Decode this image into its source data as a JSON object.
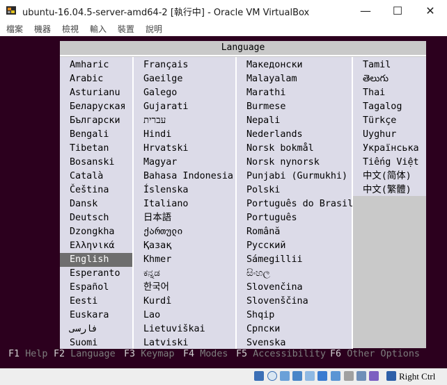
{
  "window": {
    "title": "ubuntu-16.04.5-server-amd64-2 [執行中] - Oracle VM VirtualBox",
    "minimize_glyph": "—",
    "maximize_glyph": "☐",
    "close_glyph": "✕"
  },
  "menubar": {
    "items": [
      "檔案",
      "機器",
      "檢視",
      "輸入",
      "裝置",
      "說明"
    ]
  },
  "dialog": {
    "title": "Language",
    "columns": [
      [
        "Amharic",
        "Arabic",
        "Asturianu",
        "Беларуская",
        "Български",
        "Bengali",
        "Tibetan",
        "Bosanski",
        "Català",
        "Čeština",
        "Dansk",
        "Deutsch",
        "Dzongkha",
        "Ελληνικά",
        "English",
        "Esperanto",
        "Español",
        "Eesti",
        "Euskara",
        "فارسی",
        "Suomi"
      ],
      [
        "Français",
        "Gaeilge",
        "Galego",
        "Gujarati",
        "עברית",
        "Hindi",
        "Hrvatski",
        "Magyar",
        "Bahasa Indonesia",
        "Íslenska",
        "Italiano",
        "日本語",
        "ქართული",
        "Қазақ",
        "Khmer",
        "ಕನ್ನಡ",
        "한국어",
        "Kurdî",
        "Lao",
        "Lietuviškai",
        "Latviski"
      ],
      [
        "Македонски",
        "Malayalam",
        "Marathi",
        "Burmese",
        "Nepali",
        "Nederlands",
        "Norsk bokmål",
        "Norsk nynorsk",
        "Punjabi (Gurmukhi)",
        "Polski",
        "Português do Brasil",
        "Português",
        "Română",
        "Русский",
        "Sámegillii",
        "සිංහල",
        "Slovenčina",
        "Slovenščina",
        "Shqip",
        "Српски",
        "Svenska"
      ],
      [
        "Tamil",
        "తెలుగు",
        "Thai",
        "Tagalog",
        "Türkçe",
        "Uyghur",
        "Українська",
        "Tiếng Việt",
        "中文(简体)",
        "中文(繁體)"
      ]
    ],
    "selected": "English"
  },
  "fkeys": [
    {
      "key": "F1",
      "label": "Help"
    },
    {
      "key": "F2",
      "label": "Language"
    },
    {
      "key": "F3",
      "label": "Keymap"
    },
    {
      "key": "F4",
      "label": "Modes"
    },
    {
      "key": "F5",
      "label": "Accessibility"
    },
    {
      "key": "F6",
      "label": "Other Options"
    }
  ],
  "statusbar": {
    "icons": [
      "hard-disk-icon",
      "optical-drive-icon",
      "audio-icon",
      "network-icon",
      "usb-icon",
      "shared-folder-icon",
      "display-icon",
      "recording-icon",
      "mouse-integration-icon",
      "cpu-icon",
      "arrow-icon"
    ],
    "host_key": "Right Ctrl"
  },
  "colors": {
    "console_bg": "#2c001e",
    "dialog_bg": "#c9c9c9",
    "list_bg": "#dcdbe8",
    "selected_bg": "#6e6e6e"
  }
}
